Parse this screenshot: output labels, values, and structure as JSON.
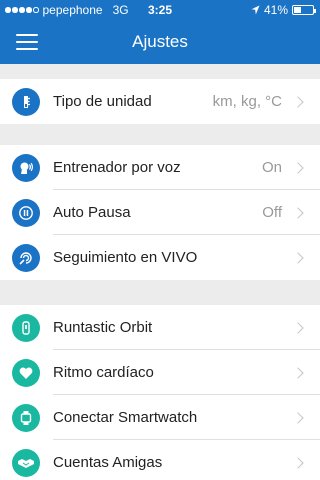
{
  "status_bar": {
    "signal_bars_filled": 4,
    "signal_bars_total": 5,
    "carrier": "pepephone",
    "network": "3G",
    "time": "3:25",
    "battery": "41%",
    "battery_level": 0.41
  },
  "header": {
    "title": "Ajustes",
    "menu_icon": "hamburger-menu-icon"
  },
  "settings": {
    "group1": [
      {
        "label": "Tipo de unidad",
        "value": "km, kg, °C",
        "icon": "units-icon",
        "icon_color": "#1a73c4"
      }
    ],
    "group2": [
      {
        "label": "Entrenador por voz",
        "value": "On",
        "icon": "voice-coach-icon",
        "icon_color": "#1a73c4"
      },
      {
        "label": "Auto Pausa",
        "value": "Off",
        "icon": "pause-icon",
        "icon_color": "#1a73c4"
      },
      {
        "label": "Seguimiento en VIVO",
        "value": "",
        "icon": "live-tracking-icon",
        "icon_color": "#1a73c4"
      }
    ],
    "group3": [
      {
        "label": "Runtastic Orbit",
        "value": "",
        "icon": "orbit-band-icon",
        "icon_color": "#1ab8a0"
      },
      {
        "label": "Ritmo cardíaco",
        "value": "",
        "icon": "heart-icon",
        "icon_color": "#1ab8a0"
      },
      {
        "label": "Conectar Smartwatch",
        "value": "",
        "icon": "smartwatch-icon",
        "icon_color": "#1ab8a0"
      },
      {
        "label": "Cuentas Amigas",
        "value": "",
        "icon": "handshake-icon",
        "icon_color": "#1ab8a0"
      }
    ]
  },
  "colors": {
    "primary": "#1a73c4",
    "accent": "#1ab8a0",
    "background": "#ececec"
  }
}
